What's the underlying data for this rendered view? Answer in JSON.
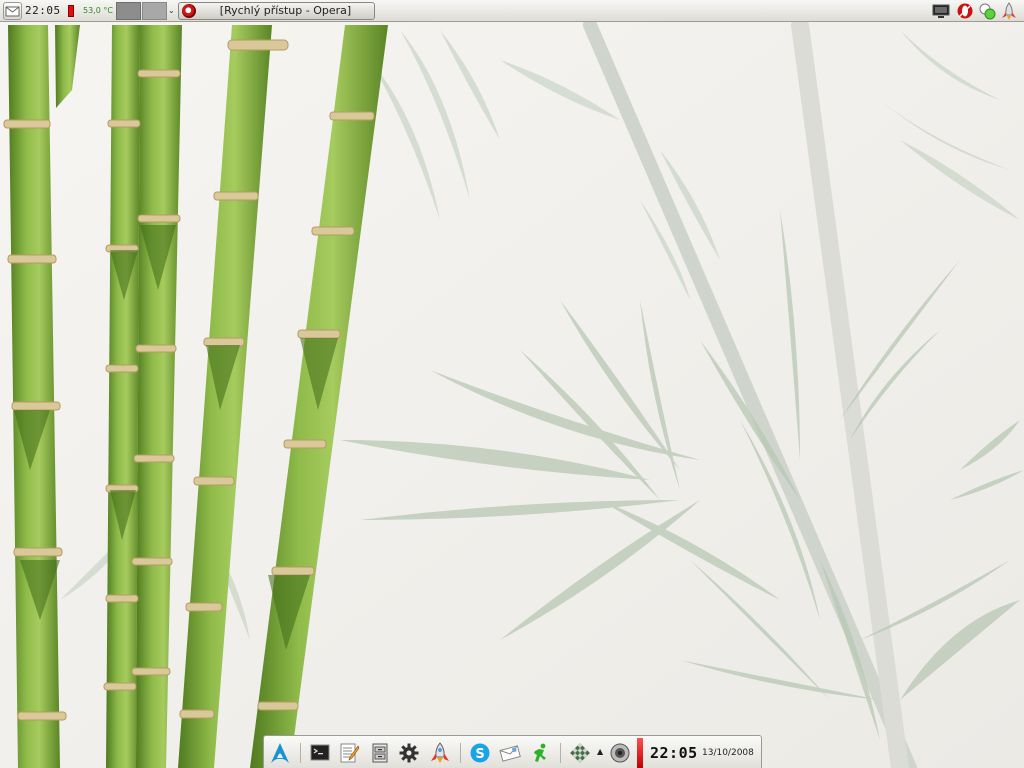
{
  "wallpaper": {
    "theme": "bamboo",
    "accent": "#6f9a34",
    "ink": "#8aa28a"
  },
  "top_panel": {
    "menu_icon": "mail-icon",
    "clock": "22:05",
    "temperature": "53,0 °C",
    "temperature_color": "#e01010",
    "pager": [
      "desktop-1",
      "desktop-2"
    ],
    "task": {
      "label": "[Rychlý přístup - Opera]",
      "icon": "opera-icon"
    },
    "tray": [
      "monitor-icon",
      "opera-icon",
      "network-icon",
      "rocket-icon"
    ]
  },
  "dock": {
    "launchers": [
      "arch-logo-icon",
      "terminal-icon",
      "text-editor-icon",
      "file-cabinet-icon",
      "settings-gear-icon",
      "rocket-icon",
      "skype-icon",
      "mail-icon",
      "running-man-icon",
      "chessboard-icon",
      "volume-icon"
    ],
    "clock": "22:05",
    "date": "13/10/2008"
  }
}
